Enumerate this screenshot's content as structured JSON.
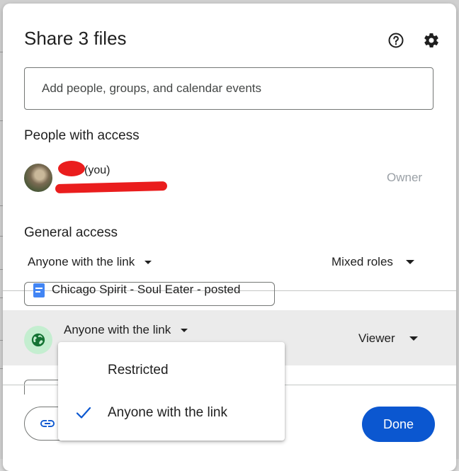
{
  "dialog": {
    "title": "Share 3 files",
    "help_icon": "help-icon",
    "settings_icon": "gear-icon"
  },
  "add_people": {
    "placeholder": "Add people, groups, and calendar events"
  },
  "people_with_access": {
    "heading": "People with access",
    "user": {
      "you_label": "(you)",
      "role": "Owner"
    }
  },
  "general_access": {
    "heading": "General access",
    "access_selector": "Anyone with the link",
    "roles_selector": "Mixed roles",
    "file": {
      "name": "Chicago Spirit - Soul Eater - posted",
      "icon": "doc-icon",
      "access_selector": "Anyone with the link",
      "role_selector": "Viewer"
    }
  },
  "access_menu": {
    "items": [
      {
        "label": "Restricted",
        "checked": false
      },
      {
        "label": "Anyone with the link",
        "checked": true
      }
    ]
  },
  "footer": {
    "copy_link_icon": "link-icon",
    "done_label": "Done"
  },
  "colors": {
    "accent": "#0b57d0",
    "check": "#0b57d0",
    "globe_bg": "#c4eed0",
    "globe": "#137333",
    "muted": "#9aa0a6",
    "redaction": "#ea1d1d"
  }
}
